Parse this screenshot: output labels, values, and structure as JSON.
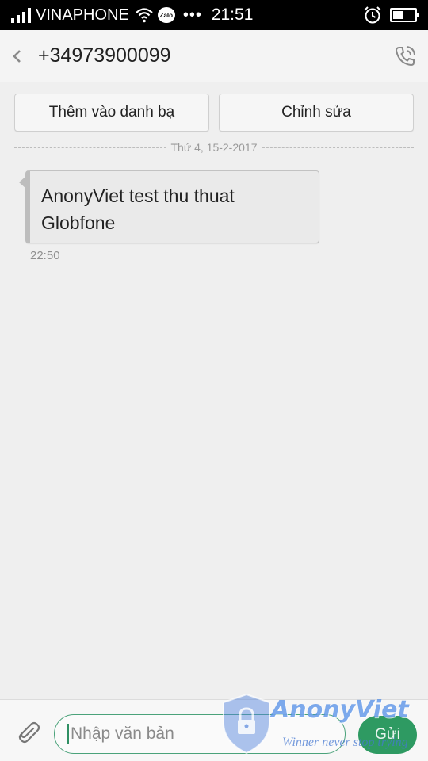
{
  "status_bar": {
    "carrier": "VINAPHONE",
    "zalo_badge": "Zalo",
    "more_indicator": "•••",
    "time": "21:51",
    "icons": [
      "signal-icon",
      "wifi-icon",
      "zalo-icon",
      "alarm-icon",
      "battery-icon"
    ]
  },
  "header": {
    "title": "+34973900099",
    "back_icon": "chevron-left-icon",
    "call_icon": "phone-call-icon"
  },
  "actions": {
    "add_contact_label": "Thêm vào danh bạ",
    "edit_label": "Chỉnh sửa"
  },
  "conversation": {
    "date_separator": "Thứ 4, 15-2-2017",
    "messages": [
      {
        "text": "AnonyViet test thu thuat Globfone",
        "time": "22:50"
      }
    ]
  },
  "composer": {
    "attach_icon": "paperclip-icon",
    "placeholder": "Nhập văn bản",
    "value": "",
    "send_label": "Gửi"
  },
  "watermark": {
    "name": "AnonyViet",
    "slogan": "Winner never stop trying"
  },
  "colors": {
    "status_bar_bg": "#000000",
    "background": "#efefef",
    "accent_green": "#2e9a62",
    "input_border": "#4aa27a",
    "watermark_blue": "#508ce6"
  }
}
